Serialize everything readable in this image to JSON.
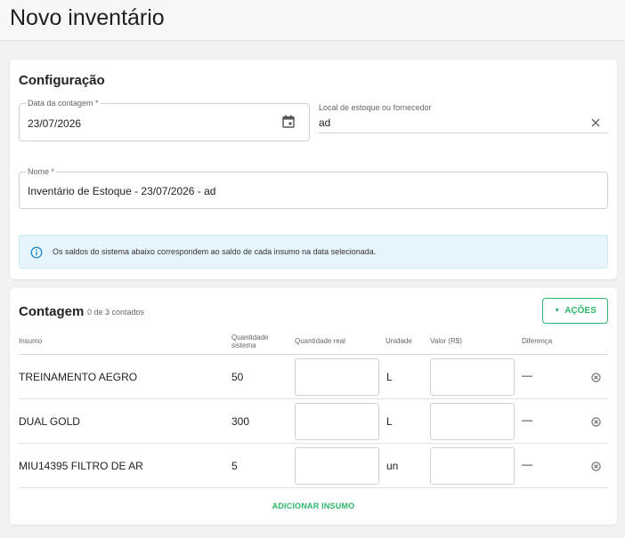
{
  "page": {
    "title": "Novo inventário"
  },
  "config": {
    "title": "Configuração",
    "date_label": "Data da contagem *",
    "date_value": "23/07/2026",
    "location_label": "Local de estoque ou fornecedor",
    "location_value": "ad",
    "name_label": "Nome *",
    "name_value": "Inventário de Estoque - 23/07/2026 - ad",
    "info_text": "Os saldos do sistema abaixo correspondem ao saldo de cada insumo na data selecionada."
  },
  "count": {
    "title": "Contagem",
    "subtitle": "0 de 3 contados",
    "actions_label": "AÇÕES",
    "columns": {
      "item": "Insumo",
      "system_qty_1": "Quantidade",
      "system_qty_2": "sistema",
      "real_qty": "Quantidade real",
      "unit": "Unidade",
      "value": "Valor (R$)",
      "difference": "Diferença"
    },
    "rows": [
      {
        "item": "TREINAMENTO AEGRO",
        "system_qty": "50",
        "unit": "L",
        "difference": "—"
      },
      {
        "item": "DUAL GOLD",
        "system_qty": "300",
        "unit": "L",
        "difference": "—"
      },
      {
        "item": "MIU14395 FILTRO DE AR",
        "system_qty": "5",
        "unit": "un",
        "difference": "—"
      }
    ],
    "add_label": "ADICIONAR INSUMO"
  },
  "colors": {
    "accent": "#2db56a",
    "info_bg": "#e5f5fb",
    "info_icon": "#1e88c9"
  },
  "icons": [
    "calendar-icon",
    "close-icon",
    "info-icon",
    "caret-down-icon",
    "remove-circle-icon"
  ]
}
